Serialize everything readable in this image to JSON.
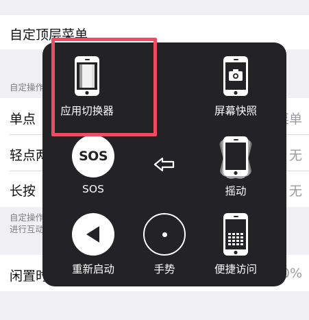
{
  "settings": {
    "top_menu_label": "自定顶层菜单",
    "actions_header": "自定操作",
    "rows": [
      {
        "label": "单点",
        "value": "菜单"
      },
      {
        "label": "轻点两下",
        "value": "无"
      },
      {
        "label": "长按",
        "value": "无"
      }
    ],
    "actions_footer_line1": "自定操作",
    "actions_footer_line2": "进行互动",
    "idle_label": "闲置时",
    "idle_value": "40%"
  },
  "menu": {
    "items": [
      {
        "label": "应用切换器",
        "icon": "app-switcher-icon"
      },
      {
        "label": "屏幕快照",
        "icon": "screenshot-icon"
      },
      {
        "label": "SOS",
        "icon": "sos-icon",
        "badge": "SOS"
      },
      {
        "label": "",
        "icon": "back-arrow-icon"
      },
      {
        "label": "摇动",
        "icon": "shake-icon"
      },
      {
        "label": "重新启动",
        "icon": "restart-icon"
      },
      {
        "label": "手势",
        "icon": "gestures-icon"
      },
      {
        "label": "便捷访问",
        "icon": "reachability-icon"
      }
    ]
  },
  "colors": {
    "menu_background": "#232325",
    "highlight": "#ee4c63",
    "page_background": "#efeff4"
  }
}
